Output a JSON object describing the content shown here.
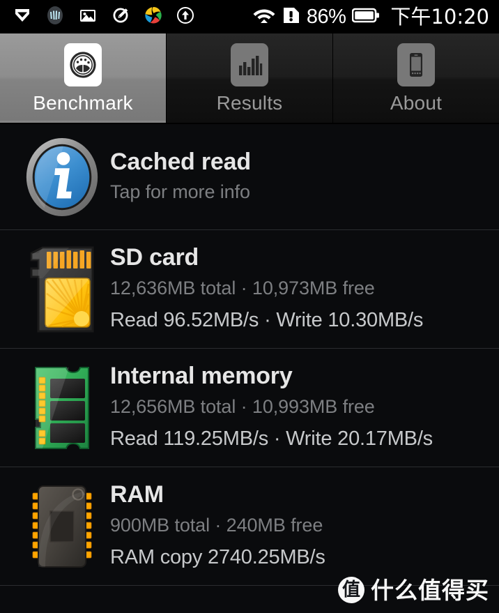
{
  "statusbar": {
    "icons": [
      {
        "name": "chevron-badge-icon",
        "label": "chevron-badge"
      },
      {
        "name": "app-circle-icon",
        "label": "app-circle"
      },
      {
        "name": "gallery-image-icon",
        "label": "gallery-image"
      },
      {
        "name": "edit-pencil-circle-icon",
        "label": "edit-pencil-circle"
      },
      {
        "name": "sina-weibo-icon",
        "label": "sina-weibo"
      },
      {
        "name": "upload-arrow-circle-icon",
        "label": "upload-arrow-circle"
      }
    ],
    "wifi_icon": "wifi-icon",
    "sim_alert_icon": "sim-alert-icon",
    "battery_percent": "86%",
    "battery_icon": "battery-full-icon",
    "clock": "下午10:20"
  },
  "tabs": [
    {
      "label": "Benchmark",
      "icon": "speedometer-icon",
      "active": true
    },
    {
      "label": "Results",
      "icon": "bar-chart-icon",
      "active": false
    },
    {
      "label": "About",
      "icon": "phone-icon",
      "active": false
    }
  ],
  "rows": [
    {
      "id": "cached-read",
      "icon": "info-circle-icon",
      "title": "Cached read",
      "subtitle": "Tap for more info",
      "stat": ""
    },
    {
      "id": "sd-card",
      "icon": "sd-card-icon",
      "title": "SD card",
      "subtitle": "12,636MB total · 10,973MB free",
      "stat": "Read 96.52MB/s · Write 10.30MB/s"
    },
    {
      "id": "internal-memory",
      "icon": "memory-module-icon",
      "title": "Internal memory",
      "subtitle": "12,656MB total · 10,993MB free",
      "stat": "Read 119.25MB/s · Write 20.17MB/s"
    },
    {
      "id": "ram",
      "icon": "ram-chip-icon",
      "title": "RAM",
      "subtitle": "900MB total · 240MB free",
      "stat": "RAM copy 2740.25MB/s"
    }
  ],
  "watermark": {
    "badge": "值",
    "text": "什么值得买"
  },
  "colors": {
    "background": "#0a0b0d",
    "statusbar": "#000000",
    "tab_active_bg": "#8d8d8d",
    "tab_inactive_bg": "#1d1d1d",
    "title_text": "#e6e6e6",
    "subtitle_text": "#7d7f82",
    "stat_text": "#c7c9cb",
    "divider": "#2b2d30",
    "sd_card_accent": "#ffc20e",
    "memory_accent": "#2faa55",
    "info_accent": "#2a7fc9"
  }
}
